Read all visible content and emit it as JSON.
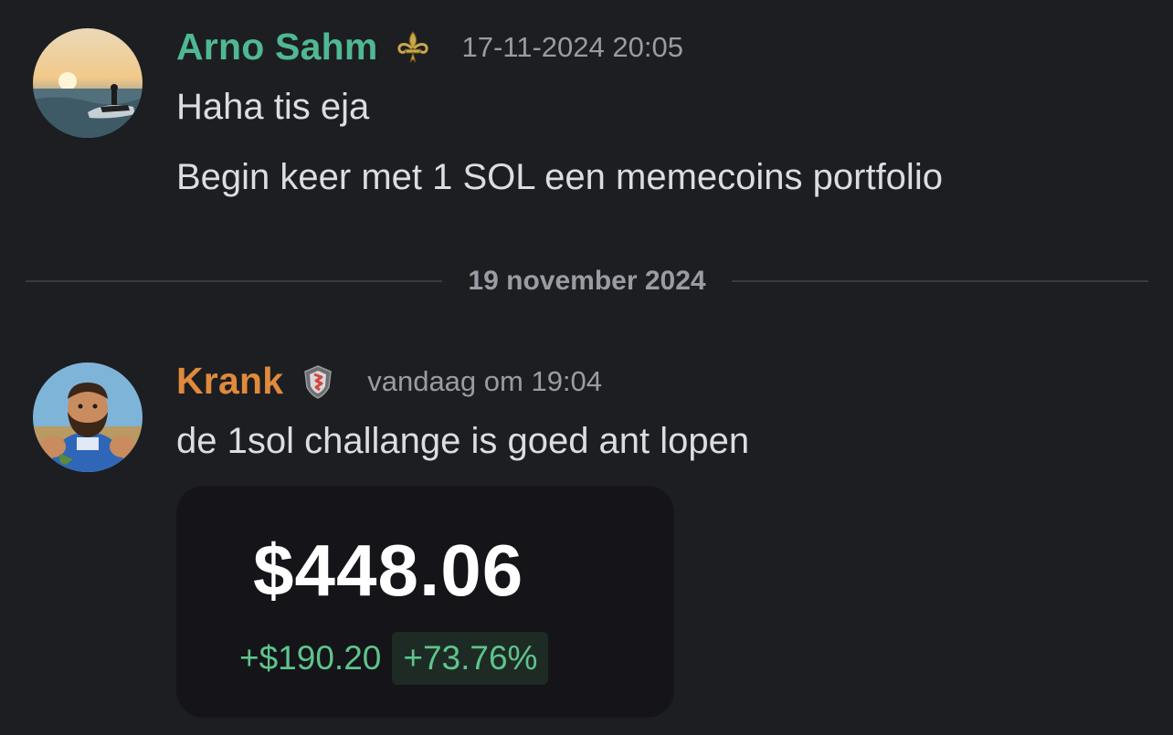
{
  "messages": [
    {
      "username": "Arno Sahm",
      "username_color": "#4fb893",
      "badge_icon": "fleur-de-lis-icon",
      "timestamp": "17-11-2024 20:05",
      "lines": [
        "Haha tis eja",
        "Begin keer met 1 SOL een memecoins portfolio"
      ]
    },
    {
      "username": "Krank",
      "username_color": "#e08a3c",
      "badge_icon": "shield-icon",
      "timestamp": "vandaag om 19:04",
      "lines": [
        "de 1sol challange is goed ant lopen"
      ],
      "attachment": {
        "amount": "$448.06",
        "change_abs": "+$190.20",
        "change_pct": "+73.76%",
        "positive_color": "#5ec48c"
      }
    }
  ],
  "date_divider": "19 november 2024",
  "colors": {
    "background": "#1d1e22",
    "text": "#dcdde1",
    "muted": "#9a9ca3",
    "card_background": "#141419"
  }
}
